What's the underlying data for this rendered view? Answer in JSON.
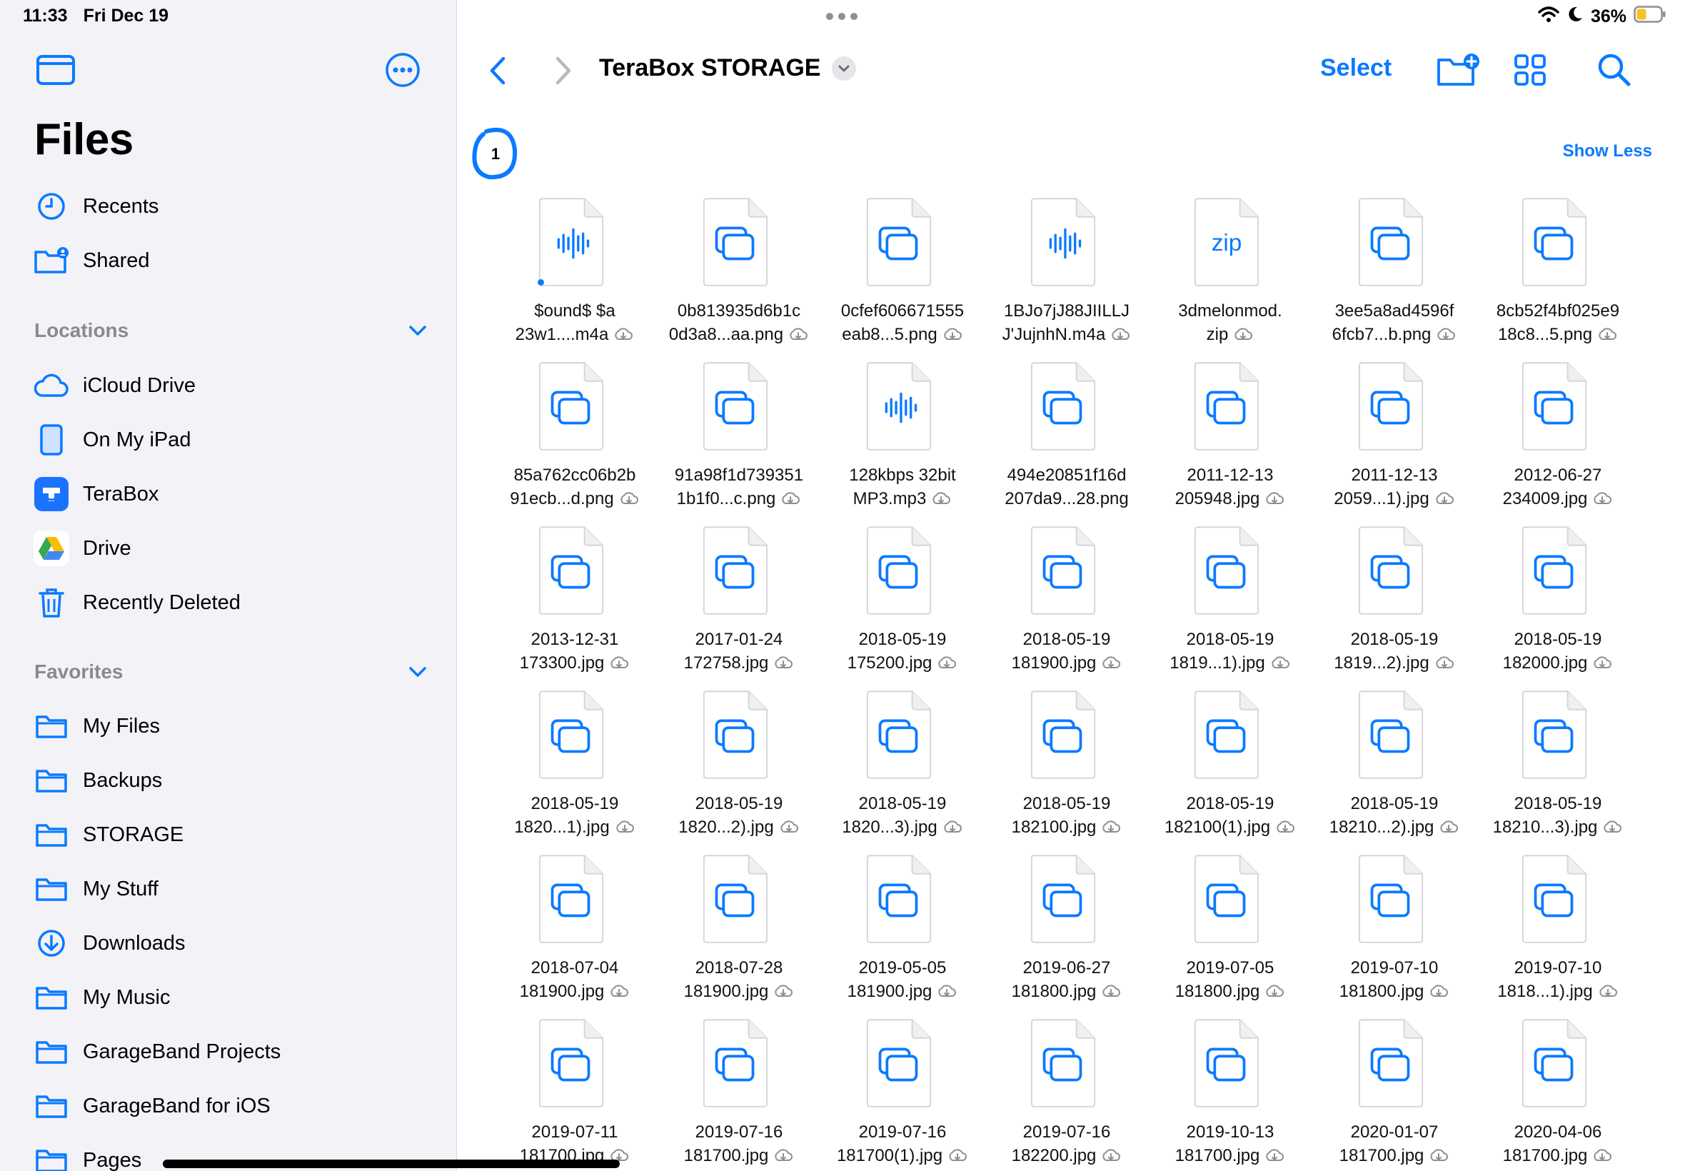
{
  "status": {
    "time": "11:33",
    "date": "Fri Dec 19",
    "battery": "36%"
  },
  "sidebar": {
    "title": "Files",
    "top_items": [
      {
        "label": "Recents",
        "icon": "clock-icon"
      },
      {
        "label": "Shared",
        "icon": "shared-folder-icon"
      }
    ],
    "locations_header": "Locations",
    "locations": [
      {
        "label": "iCloud Drive",
        "icon": "cloud-icon"
      },
      {
        "label": "On My iPad",
        "icon": "ipad-icon"
      },
      {
        "label": "TeraBox",
        "icon": "terabox-icon"
      },
      {
        "label": "Drive",
        "icon": "google-drive-icon"
      },
      {
        "label": "Recently Deleted",
        "icon": "trash-icon"
      }
    ],
    "favorites_header": "Favorites",
    "favorites": [
      {
        "label": "My Files",
        "icon": "folder-icon"
      },
      {
        "label": "Backups",
        "icon": "folder-icon"
      },
      {
        "label": "STORAGE",
        "icon": "folder-icon"
      },
      {
        "label": "My Stuff",
        "icon": "folder-icon"
      },
      {
        "label": "Downloads",
        "icon": "download-icon"
      },
      {
        "label": "My Music",
        "icon": "folder-icon"
      },
      {
        "label": "GarageBand Projects",
        "icon": "folder-icon"
      },
      {
        "label": "GarageBand for iOS",
        "icon": "folder-icon"
      },
      {
        "label": "Pages",
        "icon": "folder-icon"
      }
    ]
  },
  "toolbar": {
    "folder_title": "TeraBox STORAGE",
    "select_label": "Select",
    "show_less": "Show Less",
    "badge_number": "1"
  },
  "colors": {
    "accent": "#0a7aff",
    "sidebar_bg": "#f2f2f7"
  },
  "files": [
    {
      "line1": "$ound$ $a",
      "line2": "23w1....m4a",
      "type": "audio",
      "dot": true
    },
    {
      "line1": "0b813935d6b1c",
      "line2": "0d3a8...aa.png",
      "type": "image"
    },
    {
      "line1": "0cfef606671555",
      "line2": "eab8...5.png",
      "type": "image"
    },
    {
      "line1": "1BJo7jJ88JIILLJ",
      "line2": "J'JujnhN.m4a",
      "type": "audio"
    },
    {
      "line1": "3dmelonmod.",
      "line2": "zip",
      "type": "zip"
    },
    {
      "line1": "3ee5a8ad4596f",
      "line2": "6fcb7...b.png",
      "type": "image"
    },
    {
      "line1": "8cb52f4bf025e9",
      "line2": "18c8...5.png",
      "type": "image"
    },
    {
      "line1": "85a762cc06b2b",
      "line2": "91ecb...d.png",
      "type": "image"
    },
    {
      "line1": "91a98f1d739351",
      "line2": "1b1f0...c.png",
      "type": "image"
    },
    {
      "line1": "128kbps 32bit",
      "line2": "MP3.mp3",
      "type": "audio"
    },
    {
      "line1": "494e20851f16d",
      "line2": "207da9...28.png",
      "type": "image",
      "nocloud": true
    },
    {
      "line1": "2011-12-13",
      "line2": "205948.jpg",
      "type": "image"
    },
    {
      "line1": "2011-12-13",
      "line2": "2059...1).jpg",
      "type": "image"
    },
    {
      "line1": "2012-06-27",
      "line2": "234009.jpg",
      "type": "image"
    },
    {
      "line1": "2013-12-31",
      "line2": "173300.jpg",
      "type": "image"
    },
    {
      "line1": "2017-01-24",
      "line2": "172758.jpg",
      "type": "image"
    },
    {
      "line1": "2018-05-19",
      "line2": "175200.jpg",
      "type": "image"
    },
    {
      "line1": "2018-05-19",
      "line2": "181900.jpg",
      "type": "image"
    },
    {
      "line1": "2018-05-19",
      "line2": "1819...1).jpg",
      "type": "image"
    },
    {
      "line1": "2018-05-19",
      "line2": "1819...2).jpg",
      "type": "image"
    },
    {
      "line1": "2018-05-19",
      "line2": "182000.jpg",
      "type": "image"
    },
    {
      "line1": "2018-05-19",
      "line2": "1820...1).jpg",
      "type": "image"
    },
    {
      "line1": "2018-05-19",
      "line2": "1820...2).jpg",
      "type": "image"
    },
    {
      "line1": "2018-05-19",
      "line2": "1820...3).jpg",
      "type": "image"
    },
    {
      "line1": "2018-05-19",
      "line2": "182100.jpg",
      "type": "image"
    },
    {
      "line1": "2018-05-19",
      "line2": "182100(1).jpg",
      "type": "image"
    },
    {
      "line1": "2018-05-19",
      "line2": "18210...2).jpg",
      "type": "image"
    },
    {
      "line1": "2018-05-19",
      "line2": "18210...3).jpg",
      "type": "image"
    },
    {
      "line1": "2018-07-04",
      "line2": "181900.jpg",
      "type": "image"
    },
    {
      "line1": "2018-07-28",
      "line2": "181900.jpg",
      "type": "image"
    },
    {
      "line1": "2019-05-05",
      "line2": "181900.jpg",
      "type": "image"
    },
    {
      "line1": "2019-06-27",
      "line2": "181800.jpg",
      "type": "image"
    },
    {
      "line1": "2019-07-05",
      "line2": "181800.jpg",
      "type": "image"
    },
    {
      "line1": "2019-07-10",
      "line2": "181800.jpg",
      "type": "image"
    },
    {
      "line1": "2019-07-10",
      "line2": "1818...1).jpg",
      "type": "image"
    },
    {
      "line1": "2019-07-11",
      "line2": "181700.jpg",
      "type": "image"
    },
    {
      "line1": "2019-07-16",
      "line2": "181700.jpg",
      "type": "image"
    },
    {
      "line1": "2019-07-16",
      "line2": "181700(1).jpg",
      "type": "image"
    },
    {
      "line1": "2019-07-16",
      "line2": "182200.jpg",
      "type": "image"
    },
    {
      "line1": "2019-10-13",
      "line2": "181700.jpg",
      "type": "image"
    },
    {
      "line1": "2020-01-07",
      "line2": "181700.jpg",
      "type": "image"
    },
    {
      "line1": "2020-04-06",
      "line2": "181700.jpg",
      "type": "image"
    }
  ]
}
